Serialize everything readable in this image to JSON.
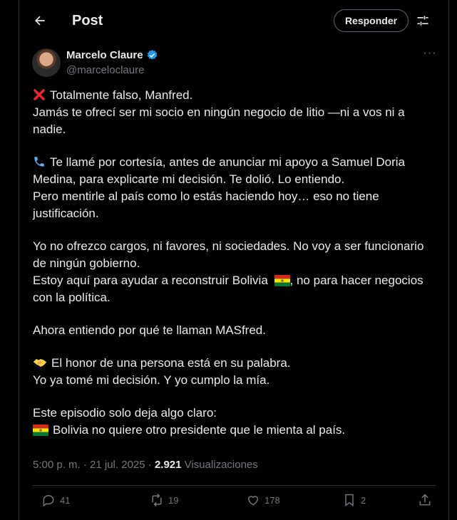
{
  "header": {
    "title": "Post",
    "reply_label": "Responder"
  },
  "author": {
    "name": "Marcelo Claure",
    "handle": "@marceloclaure"
  },
  "post": {
    "p1": [
      "Totalmente falso, Manfred.",
      "Jamás te ofrecí ser mi socio en ningún negocio de litio —ni a vos ni a nadie."
    ],
    "p2": [
      "Te llamé por cortesía, antes de anunciar mi apoyo a Samuel Doria Medina, para explicarte mi decisión. Te dolió. Lo entiendo.",
      "Pero mentirle al país como lo estás haciendo hoy… eso no tiene justificación."
    ],
    "p3": [
      "Yo no ofrezco cargos, ni favores, ni sociedades. No voy a ser funcionario de ningún gobierno.",
      "Estoy aquí para ayudar a reconstruir Bolivia",
      ", no para hacer negocios con la política."
    ],
    "p4": "Ahora entiendo por qué te llaman MASfred.",
    "p5": [
      "El honor de una persona está en su palabra.",
      "Yo ya tomé mi decisión. Y yo cumplo la mía."
    ],
    "p6": [
      "Este episodio solo deja algo claro:",
      "Bolivia no quiere otro presidente que le mienta al país."
    ]
  },
  "meta": {
    "time": "5:00 p. m. · 21 jul. 2025 · ",
    "views_count": "2.921",
    "views_label": " Visualizaciones"
  },
  "actions": {
    "replies": "41",
    "reposts": "19",
    "likes": "178",
    "bookmarks": "2"
  },
  "colors": {
    "background": "#000000",
    "text": "#e7e9ea",
    "muted": "#71767b",
    "verified": "#1d9bf0",
    "border": "#2f3336"
  }
}
